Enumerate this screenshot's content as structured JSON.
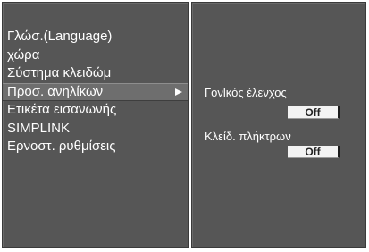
{
  "menu": {
    "items": [
      {
        "label": "Γλώσ.(Language)"
      },
      {
        "label": "χώρα"
      },
      {
        "label": "Σύστημα κλειδώμ"
      },
      {
        "label": "Προσ. ανηλίκων",
        "selected": true,
        "has_submenu": true
      },
      {
        "label": "Ετικέτα εισανωνής"
      },
      {
        "label": "SIMPLINK"
      },
      {
        "label": "Ερνοστ. ρυθμίσεις"
      }
    ],
    "submenu_arrow_icon": "triangle-right-icon"
  },
  "submenu": {
    "parental_control": {
      "label": "Γονlκός έλενχος",
      "value": "Off"
    },
    "key_lock": {
      "label": "Κλείδ. πλήκτρων",
      "value": "Off"
    }
  },
  "colors": {
    "panel_bg": "#565656",
    "selected_bg": "#6e6e6e",
    "text": "#ffffff",
    "value_box_bg": "#f3f3f3"
  }
}
